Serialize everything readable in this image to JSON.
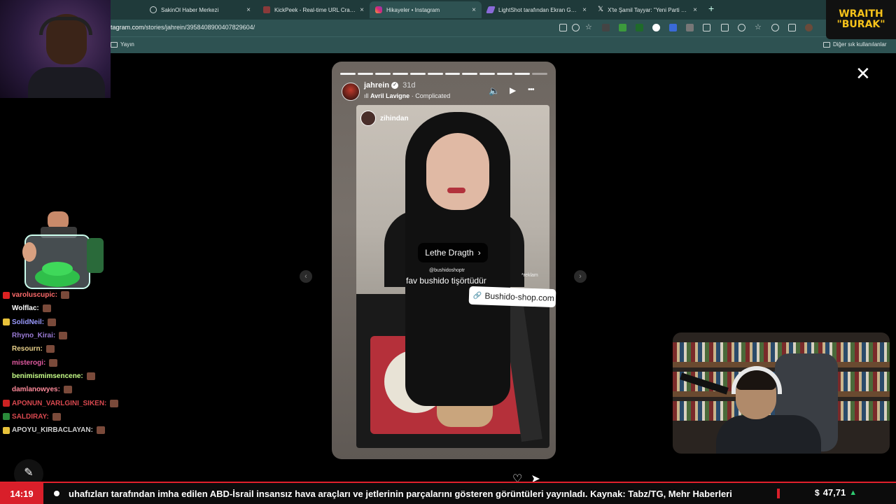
{
  "browser": {
    "tabs": [
      {
        "label": "SakinOl Haber Merkezi",
        "color": "#9fb0b0",
        "active": false
      },
      {
        "label": "KickPeek - Real-time URL Crawler",
        "color": "#8a3a3a",
        "active": false
      },
      {
        "label": "Hikayeler • Instagram",
        "color": "#d62976",
        "active": true
      },
      {
        "label": "LightShot tarafından Ekran Görün",
        "color": "#8a6ad8",
        "active": false
      },
      {
        "label": "X'te Şamil Tayyar: \"Yeni Parti Genel",
        "color": "#111111",
        "active": false
      }
    ],
    "close_glyph": "×",
    "newtab_glyph": "+",
    "url_host": "tagram.com",
    "url_path": "/stories/jahrein/3958408900407829604/",
    "bookmark_left": "Yayın",
    "bookmark_right": "Diğer sık kullanılanlar"
  },
  "overlay": {
    "brand_top": "WRAITH",
    "brand_bottom": "\"BURAK\""
  },
  "chat": [
    {
      "user": "varoluscupic:",
      "color": "#ff6b6b",
      "badge": "#d22"
    },
    {
      "user": "Wolflac:",
      "color": "#ffffff",
      "badge": "#000"
    },
    {
      "user": "SolidNeil:",
      "color": "#9a9aff",
      "badge": "#e8c23a"
    },
    {
      "user": "Rhyno_Kirai:",
      "color": "#9b7bd6",
      "badge": "#000"
    },
    {
      "user": "Resourn:",
      "color": "#e8d08a",
      "badge": "#000"
    },
    {
      "user": "misterogi:",
      "color": "#e05aa0",
      "badge": "#000"
    },
    {
      "user": "benimismimsencene:",
      "color": "#c8ff8a",
      "badge": "#000"
    },
    {
      "user": "damlanowyes:",
      "color": "#ff8a9a",
      "badge": "#000"
    },
    {
      "user": "APONUN_VARLGINI_SIKEN:",
      "color": "#d9484f",
      "badge": "#c22"
    },
    {
      "user": "SALDIRAY:",
      "color": "#d9484f",
      "badge": "#2a8a3a"
    },
    {
      "user": "APOYU_KIRBACLAYAN:",
      "color": "#cfcfcf",
      "badge": "#e8c23a"
    }
  ],
  "story": {
    "username": "jahrein",
    "verified_glyph": "✓",
    "age": "31d",
    "music_artist": "Avril Lavigne",
    "music_sep": "·",
    "music_title": "Complicated",
    "segments_total": 12,
    "segments_done": 11,
    "inner_username": "zihindan",
    "cta_label": "Lethe Dragth",
    "cta_arrow": "›",
    "handle": "@bushidoshoptr",
    "caption": "fav bushido tişörtüdür",
    "ad_label": "*reklam",
    "link_label": "Bushido-shop.com",
    "link_icon": "🔗"
  },
  "controls": {
    "mute": "🔈",
    "play": "▶",
    "more": "•••",
    "close": "✕",
    "prev": "‹",
    "next": "›",
    "like": "♡",
    "share": "➤"
  },
  "ticker": {
    "time": "14:19",
    "text": "uhafızları tarafından imha edilen ABD-İsrail insansız hava araçları ve jetlerinin parçalarını gösteren görüntüleri yayınladı. Kaynak: Tabz/TG, Mehr Haberleri",
    "currency": "$",
    "rate": "47,71",
    "trend": "▲"
  }
}
